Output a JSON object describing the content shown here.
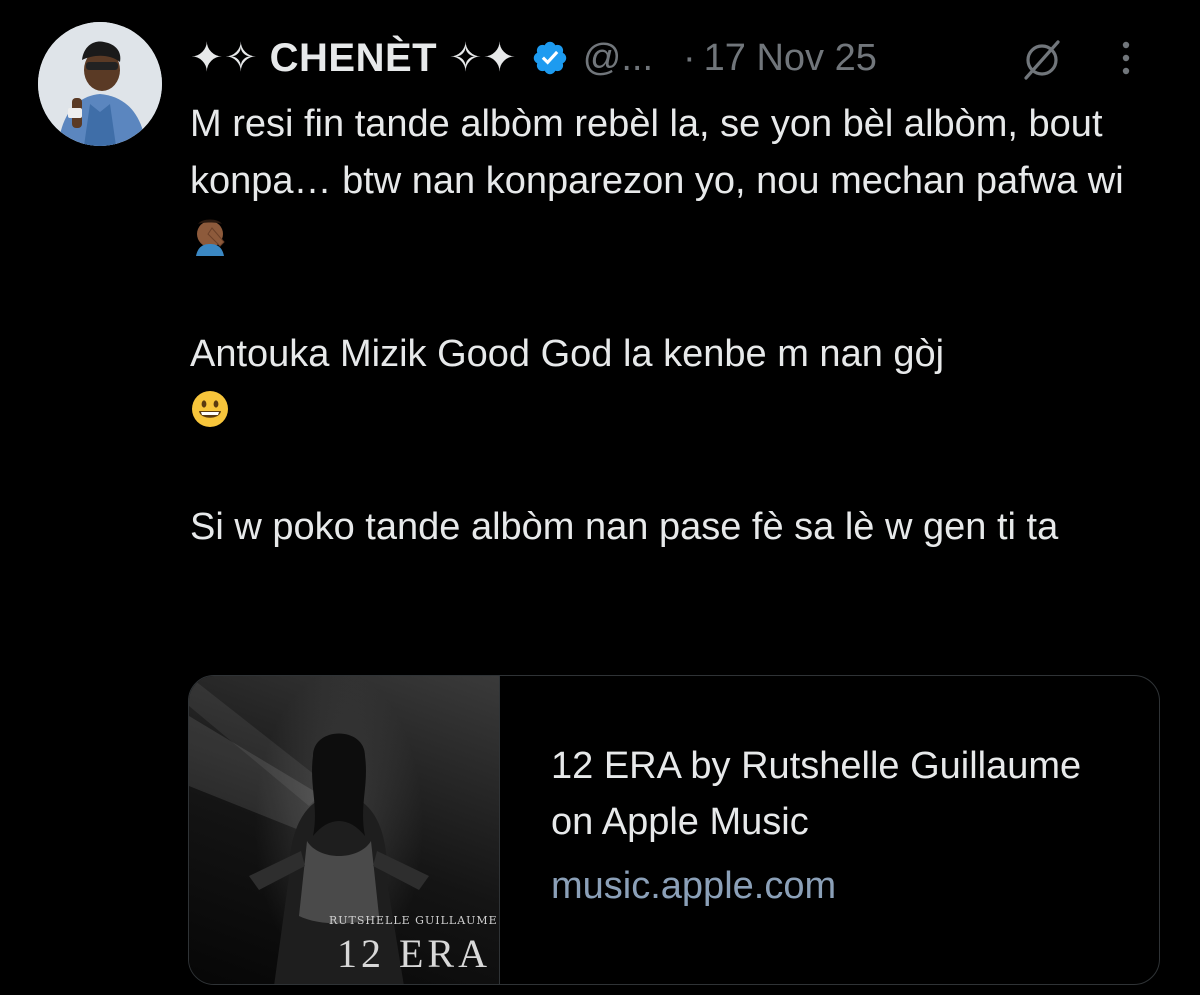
{
  "author": {
    "display_name": "✦✧ CHENÈT ✧✦",
    "handle": "@...",
    "verified": true,
    "date_separator": "·",
    "date": "17 Nov 25"
  },
  "icons": [
    "avatar",
    "verified-badge-icon",
    "grok-icon",
    "more-options-icon",
    "facepalm-emoji-icon",
    "grinning-emoji-icon"
  ],
  "colors": {
    "background": "#000000",
    "text": "#e7e9ea",
    "muted": "#71767b",
    "verified": "#1d9bf0",
    "link_domain": "#8ba0b8",
    "border": "#2f3336"
  },
  "tweet": {
    "paragraph1": "M resi fin tande albòm rebèl la, se yon bèl albòm, bout konpa… btw nan konparezon yo, nou mechan pafwa wi",
    "paragraph2": "Antouka Mizik Good God la kenbe m nan gòj",
    "paragraph3": "Si w poko tande albòm nan pase fè sa lè w gen ti ta"
  },
  "link_card": {
    "cover_artist": "RUTSHELLE GUILLAUME",
    "cover_title": "12 ERA",
    "title": "12 ERA by Rutshelle Guillaume on Apple Music",
    "domain": "music.apple.com"
  }
}
